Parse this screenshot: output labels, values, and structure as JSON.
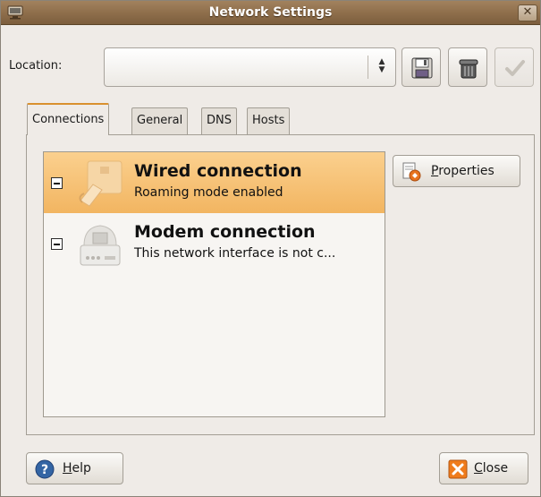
{
  "window": {
    "title": "Network Settings",
    "close_glyph": "✕"
  },
  "location": {
    "label": "Location:",
    "value": ""
  },
  "toolbar": {
    "save_icon": "floppy-disk-icon",
    "delete_icon": "trash-icon",
    "apply_icon": "checkmark-icon"
  },
  "tabs": [
    {
      "label": "Connections"
    },
    {
      "label": "General"
    },
    {
      "label": "DNS"
    },
    {
      "label": "Hosts"
    }
  ],
  "connections": [
    {
      "name": "Wired connection",
      "description": "Roaming mode enabled",
      "selected": true
    },
    {
      "name": "Modem connection",
      "description": "This network interface is not c...",
      "selected": false
    }
  ],
  "buttons": {
    "properties": {
      "mnemonic": "P",
      "rest": "roperties"
    },
    "help": {
      "mnemonic": "H",
      "rest": "elp"
    },
    "close": {
      "mnemonic": "C",
      "rest": "lose"
    }
  }
}
